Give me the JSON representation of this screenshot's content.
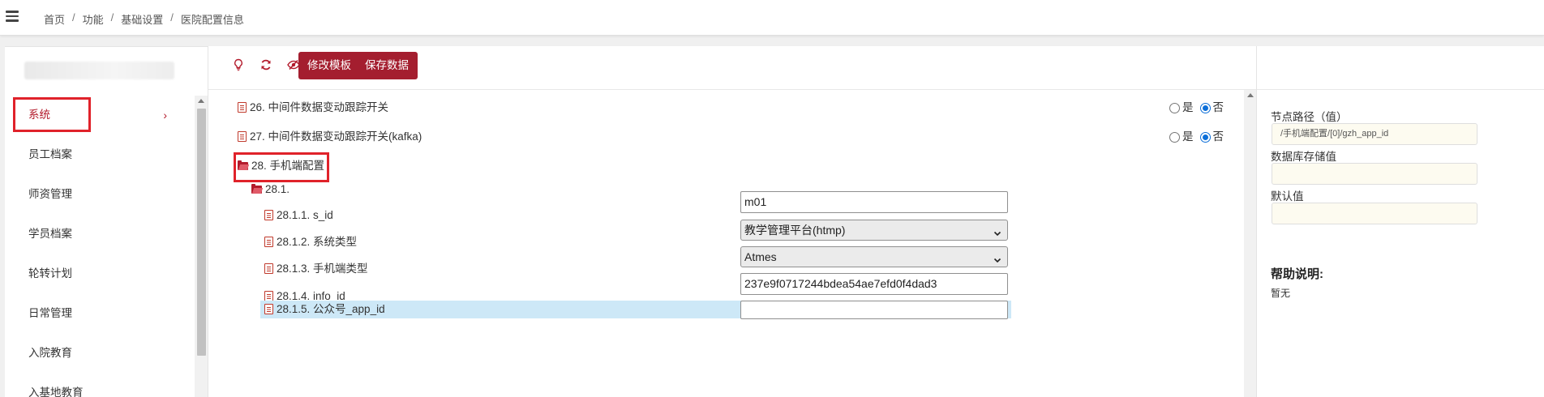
{
  "breadcrumb": {
    "items": [
      "首页",
      "功能",
      "基础设置",
      "医院配置信息"
    ],
    "separator": "/"
  },
  "sidebar": {
    "items": [
      {
        "label": "系统",
        "active": true,
        "chevron": "›"
      },
      {
        "label": "员工档案"
      },
      {
        "label": "师资管理"
      },
      {
        "label": "学员档案"
      },
      {
        "label": "轮转计划"
      },
      {
        "label": "日常管理"
      },
      {
        "label": "入院教育"
      },
      {
        "label": "入基地教育"
      }
    ]
  },
  "toolbar": {
    "icons": [
      "lightbulb-icon",
      "refresh-icon",
      "eye-slash-icon",
      "undo-icon"
    ],
    "edit_template_label": "修改模板",
    "save_data_label": "保存数据"
  },
  "tree": {
    "item26": {
      "label": "26. 中间件数据变动跟踪开关",
      "yes": "是",
      "no": "否",
      "value": "否"
    },
    "item27": {
      "label": "27. 中间件数据变动跟踪开关(kafka)",
      "yes": "是",
      "no": "否",
      "value": "否"
    },
    "item28": {
      "label": "28. 手机端配置"
    },
    "item28_1": {
      "label": "28.1."
    },
    "item28_1_1": {
      "label": "28.1.1. s_id",
      "value": "m01"
    },
    "item28_1_2": {
      "label": "28.1.2. 系统类型",
      "value": "教学管理平台(htmp)"
    },
    "item28_1_3": {
      "label": "28.1.3. 手机端类型",
      "value": "Atmes"
    },
    "item28_1_4": {
      "label": "28.1.4. info_id",
      "value": "237e9f0717244bdea54ae7efd0f4dad3"
    },
    "item28_1_5": {
      "label": "28.1.5. 公众号_app_id",
      "value": ""
    }
  },
  "right_panel": {
    "node_path_label": "节点路径（值）",
    "node_path_value": "/手机端配置/[0]/gzh_app_id",
    "db_value_label": "数据库存储值",
    "db_value": "",
    "default_label": "默认值",
    "default_value": "",
    "help_title": "帮助说明:",
    "help_text": "暂无"
  },
  "colors": {
    "accent": "#a41e2f",
    "highlight_box": "#e0222a",
    "selected_row": "#cde8f7",
    "radio_checked": "#0b6ed8"
  }
}
